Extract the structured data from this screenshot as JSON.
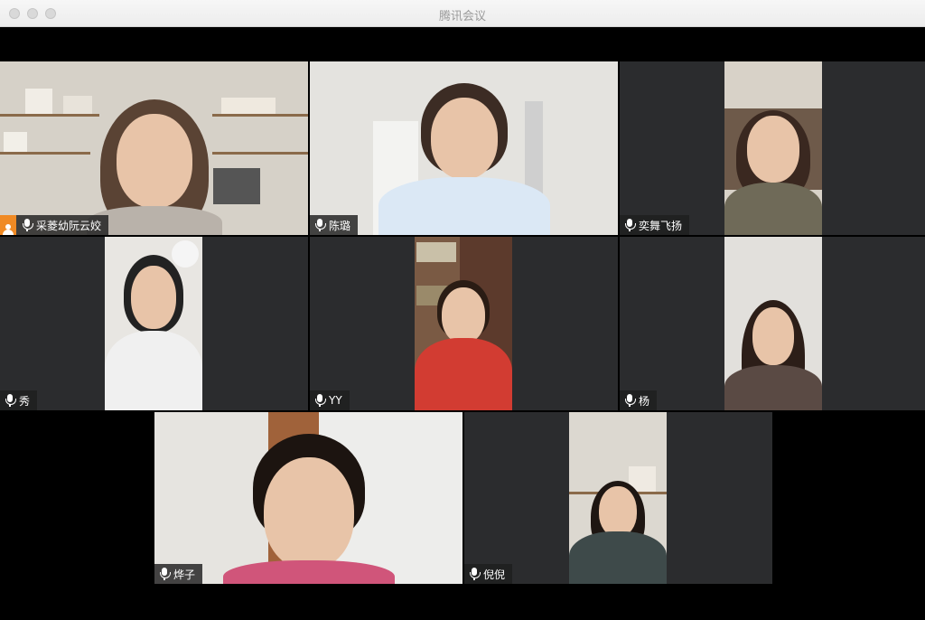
{
  "window": {
    "title": "腾讯会议"
  },
  "participants": [
    {
      "name": "采菱幼阮云姣",
      "host": true,
      "active": true
    },
    {
      "name": "陈璐"
    },
    {
      "name": "奕舞飞扬"
    },
    {
      "name": "秀"
    },
    {
      "name": "YY"
    },
    {
      "name": "杨"
    },
    {
      "name": "烨子"
    },
    {
      "name": "倪倪"
    }
  ],
  "colors": {
    "active_border": "#2ecc40",
    "host_badge": "#f08a24",
    "tile_bg": "#2b2c2e"
  }
}
